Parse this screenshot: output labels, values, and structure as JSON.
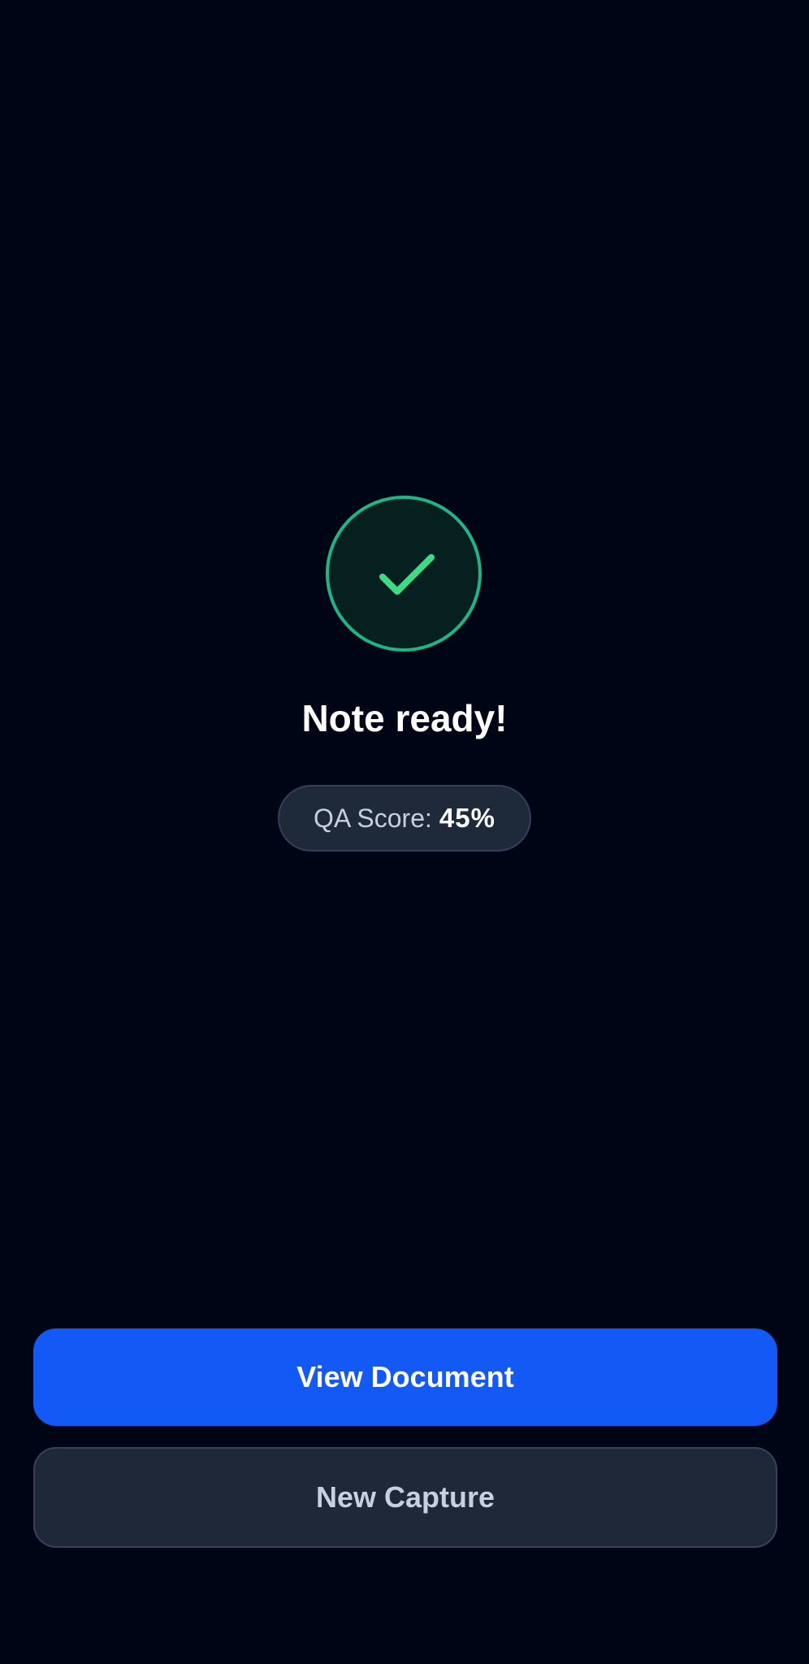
{
  "result": {
    "icon": "checkmark-icon",
    "title": "Note ready!"
  },
  "qa_score": {
    "label": "QA Score:",
    "value": "45%"
  },
  "actions": {
    "view_document_label": "View Document",
    "new_capture_label": "New Capture"
  },
  "colors": {
    "background": "#000515",
    "success_ring": "#1cb787",
    "success_fill": "#06201f",
    "checkmark": "#3ddc84",
    "primary_button": "#1359f5",
    "secondary_button": "#1e2838"
  }
}
